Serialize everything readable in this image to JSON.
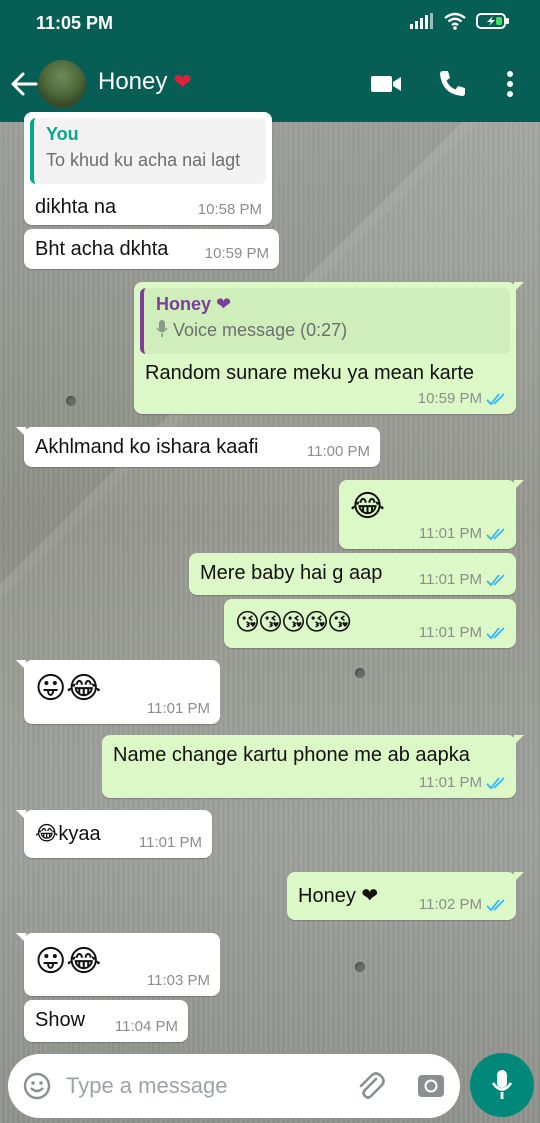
{
  "status": {
    "time": "11:05 PM"
  },
  "header": {
    "name": "Honey",
    "name_emoji": "❤"
  },
  "messages": [
    {
      "dir": "in",
      "quote_author": "You",
      "quote_text": "To khud ku acha nai lagt",
      "text": "dikhta na",
      "time": "10:58 PM"
    },
    {
      "dir": "in",
      "text": "Bht acha dkhta",
      "time": "10:59 PM"
    },
    {
      "dir": "out",
      "quote_author": "Honey ❤",
      "quote_text": "Voice message (0:27)",
      "text": "Random sunare meku ya mean karte",
      "time": "10:59 PM"
    },
    {
      "dir": "in",
      "text": "Akhlmand ko ishara kaafi",
      "time": "11:00 PM"
    },
    {
      "dir": "out",
      "text": "😂",
      "time": "11:01 PM"
    },
    {
      "dir": "out",
      "text": "Mere baby hai g aap",
      "time": "11:01 PM"
    },
    {
      "dir": "out",
      "text": "😘😘😘😘😘",
      "time": "11:01 PM"
    },
    {
      "dir": "in",
      "text": "😛😂",
      "time": "11:01 PM"
    },
    {
      "dir": "out",
      "text": "Name change kartu phone me ab aapka",
      "time": "11:01 PM"
    },
    {
      "dir": "in",
      "text": "😂kyaa",
      "time": "11:01 PM"
    },
    {
      "dir": "out",
      "text": "Honey ❤",
      "time": "11:02 PM"
    },
    {
      "dir": "in",
      "text": "😛😂",
      "time": "11:03 PM"
    },
    {
      "dir": "in",
      "text": "Show",
      "time": "11:04 PM"
    }
  ],
  "composer": {
    "placeholder": "Type a message"
  },
  "colors": {
    "header": "#075e54",
    "outgoing": "#dcf8c6",
    "incoming": "#ffffff",
    "tick_read": "#34b7f1",
    "mic_button": "#00897b",
    "you_quote": "#06a88a",
    "honey_quote": "#7b3f99"
  }
}
